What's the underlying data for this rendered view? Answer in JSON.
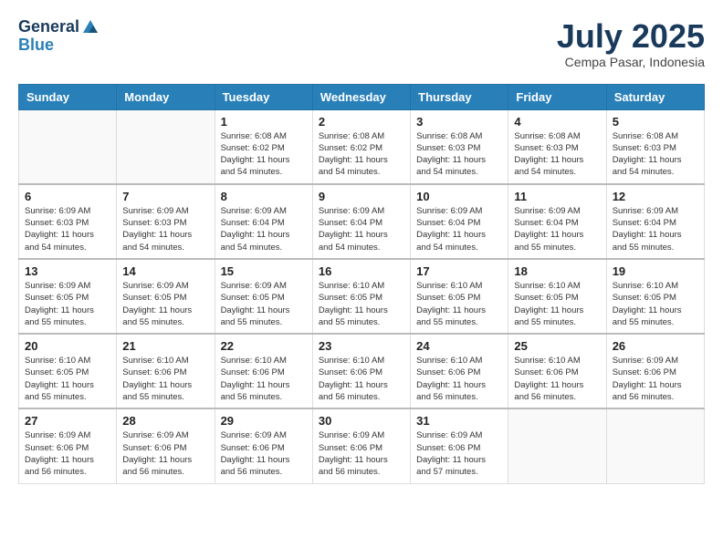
{
  "logo": {
    "general": "General",
    "blue": "Blue"
  },
  "title": "July 2025",
  "location": "Cempa Pasar, Indonesia",
  "days_of_week": [
    "Sunday",
    "Monday",
    "Tuesday",
    "Wednesday",
    "Thursday",
    "Friday",
    "Saturday"
  ],
  "weeks": [
    [
      {
        "day": "",
        "info": ""
      },
      {
        "day": "",
        "info": ""
      },
      {
        "day": "1",
        "info": "Sunrise: 6:08 AM\nSunset: 6:02 PM\nDaylight: 11 hours and 54 minutes."
      },
      {
        "day": "2",
        "info": "Sunrise: 6:08 AM\nSunset: 6:02 PM\nDaylight: 11 hours and 54 minutes."
      },
      {
        "day": "3",
        "info": "Sunrise: 6:08 AM\nSunset: 6:03 PM\nDaylight: 11 hours and 54 minutes."
      },
      {
        "day": "4",
        "info": "Sunrise: 6:08 AM\nSunset: 6:03 PM\nDaylight: 11 hours and 54 minutes."
      },
      {
        "day": "5",
        "info": "Sunrise: 6:08 AM\nSunset: 6:03 PM\nDaylight: 11 hours and 54 minutes."
      }
    ],
    [
      {
        "day": "6",
        "info": "Sunrise: 6:09 AM\nSunset: 6:03 PM\nDaylight: 11 hours and 54 minutes."
      },
      {
        "day": "7",
        "info": "Sunrise: 6:09 AM\nSunset: 6:03 PM\nDaylight: 11 hours and 54 minutes."
      },
      {
        "day": "8",
        "info": "Sunrise: 6:09 AM\nSunset: 6:04 PM\nDaylight: 11 hours and 54 minutes."
      },
      {
        "day": "9",
        "info": "Sunrise: 6:09 AM\nSunset: 6:04 PM\nDaylight: 11 hours and 54 minutes."
      },
      {
        "day": "10",
        "info": "Sunrise: 6:09 AM\nSunset: 6:04 PM\nDaylight: 11 hours and 54 minutes."
      },
      {
        "day": "11",
        "info": "Sunrise: 6:09 AM\nSunset: 6:04 PM\nDaylight: 11 hours and 55 minutes."
      },
      {
        "day": "12",
        "info": "Sunrise: 6:09 AM\nSunset: 6:04 PM\nDaylight: 11 hours and 55 minutes."
      }
    ],
    [
      {
        "day": "13",
        "info": "Sunrise: 6:09 AM\nSunset: 6:05 PM\nDaylight: 11 hours and 55 minutes."
      },
      {
        "day": "14",
        "info": "Sunrise: 6:09 AM\nSunset: 6:05 PM\nDaylight: 11 hours and 55 minutes."
      },
      {
        "day": "15",
        "info": "Sunrise: 6:09 AM\nSunset: 6:05 PM\nDaylight: 11 hours and 55 minutes."
      },
      {
        "day": "16",
        "info": "Sunrise: 6:10 AM\nSunset: 6:05 PM\nDaylight: 11 hours and 55 minutes."
      },
      {
        "day": "17",
        "info": "Sunrise: 6:10 AM\nSunset: 6:05 PM\nDaylight: 11 hours and 55 minutes."
      },
      {
        "day": "18",
        "info": "Sunrise: 6:10 AM\nSunset: 6:05 PM\nDaylight: 11 hours and 55 minutes."
      },
      {
        "day": "19",
        "info": "Sunrise: 6:10 AM\nSunset: 6:05 PM\nDaylight: 11 hours and 55 minutes."
      }
    ],
    [
      {
        "day": "20",
        "info": "Sunrise: 6:10 AM\nSunset: 6:05 PM\nDaylight: 11 hours and 55 minutes."
      },
      {
        "day": "21",
        "info": "Sunrise: 6:10 AM\nSunset: 6:06 PM\nDaylight: 11 hours and 55 minutes."
      },
      {
        "day": "22",
        "info": "Sunrise: 6:10 AM\nSunset: 6:06 PM\nDaylight: 11 hours and 56 minutes."
      },
      {
        "day": "23",
        "info": "Sunrise: 6:10 AM\nSunset: 6:06 PM\nDaylight: 11 hours and 56 minutes."
      },
      {
        "day": "24",
        "info": "Sunrise: 6:10 AM\nSunset: 6:06 PM\nDaylight: 11 hours and 56 minutes."
      },
      {
        "day": "25",
        "info": "Sunrise: 6:10 AM\nSunset: 6:06 PM\nDaylight: 11 hours and 56 minutes."
      },
      {
        "day": "26",
        "info": "Sunrise: 6:09 AM\nSunset: 6:06 PM\nDaylight: 11 hours and 56 minutes."
      }
    ],
    [
      {
        "day": "27",
        "info": "Sunrise: 6:09 AM\nSunset: 6:06 PM\nDaylight: 11 hours and 56 minutes."
      },
      {
        "day": "28",
        "info": "Sunrise: 6:09 AM\nSunset: 6:06 PM\nDaylight: 11 hours and 56 minutes."
      },
      {
        "day": "29",
        "info": "Sunrise: 6:09 AM\nSunset: 6:06 PM\nDaylight: 11 hours and 56 minutes."
      },
      {
        "day": "30",
        "info": "Sunrise: 6:09 AM\nSunset: 6:06 PM\nDaylight: 11 hours and 56 minutes."
      },
      {
        "day": "31",
        "info": "Sunrise: 6:09 AM\nSunset: 6:06 PM\nDaylight: 11 hours and 57 minutes."
      },
      {
        "day": "",
        "info": ""
      },
      {
        "day": "",
        "info": ""
      }
    ]
  ]
}
